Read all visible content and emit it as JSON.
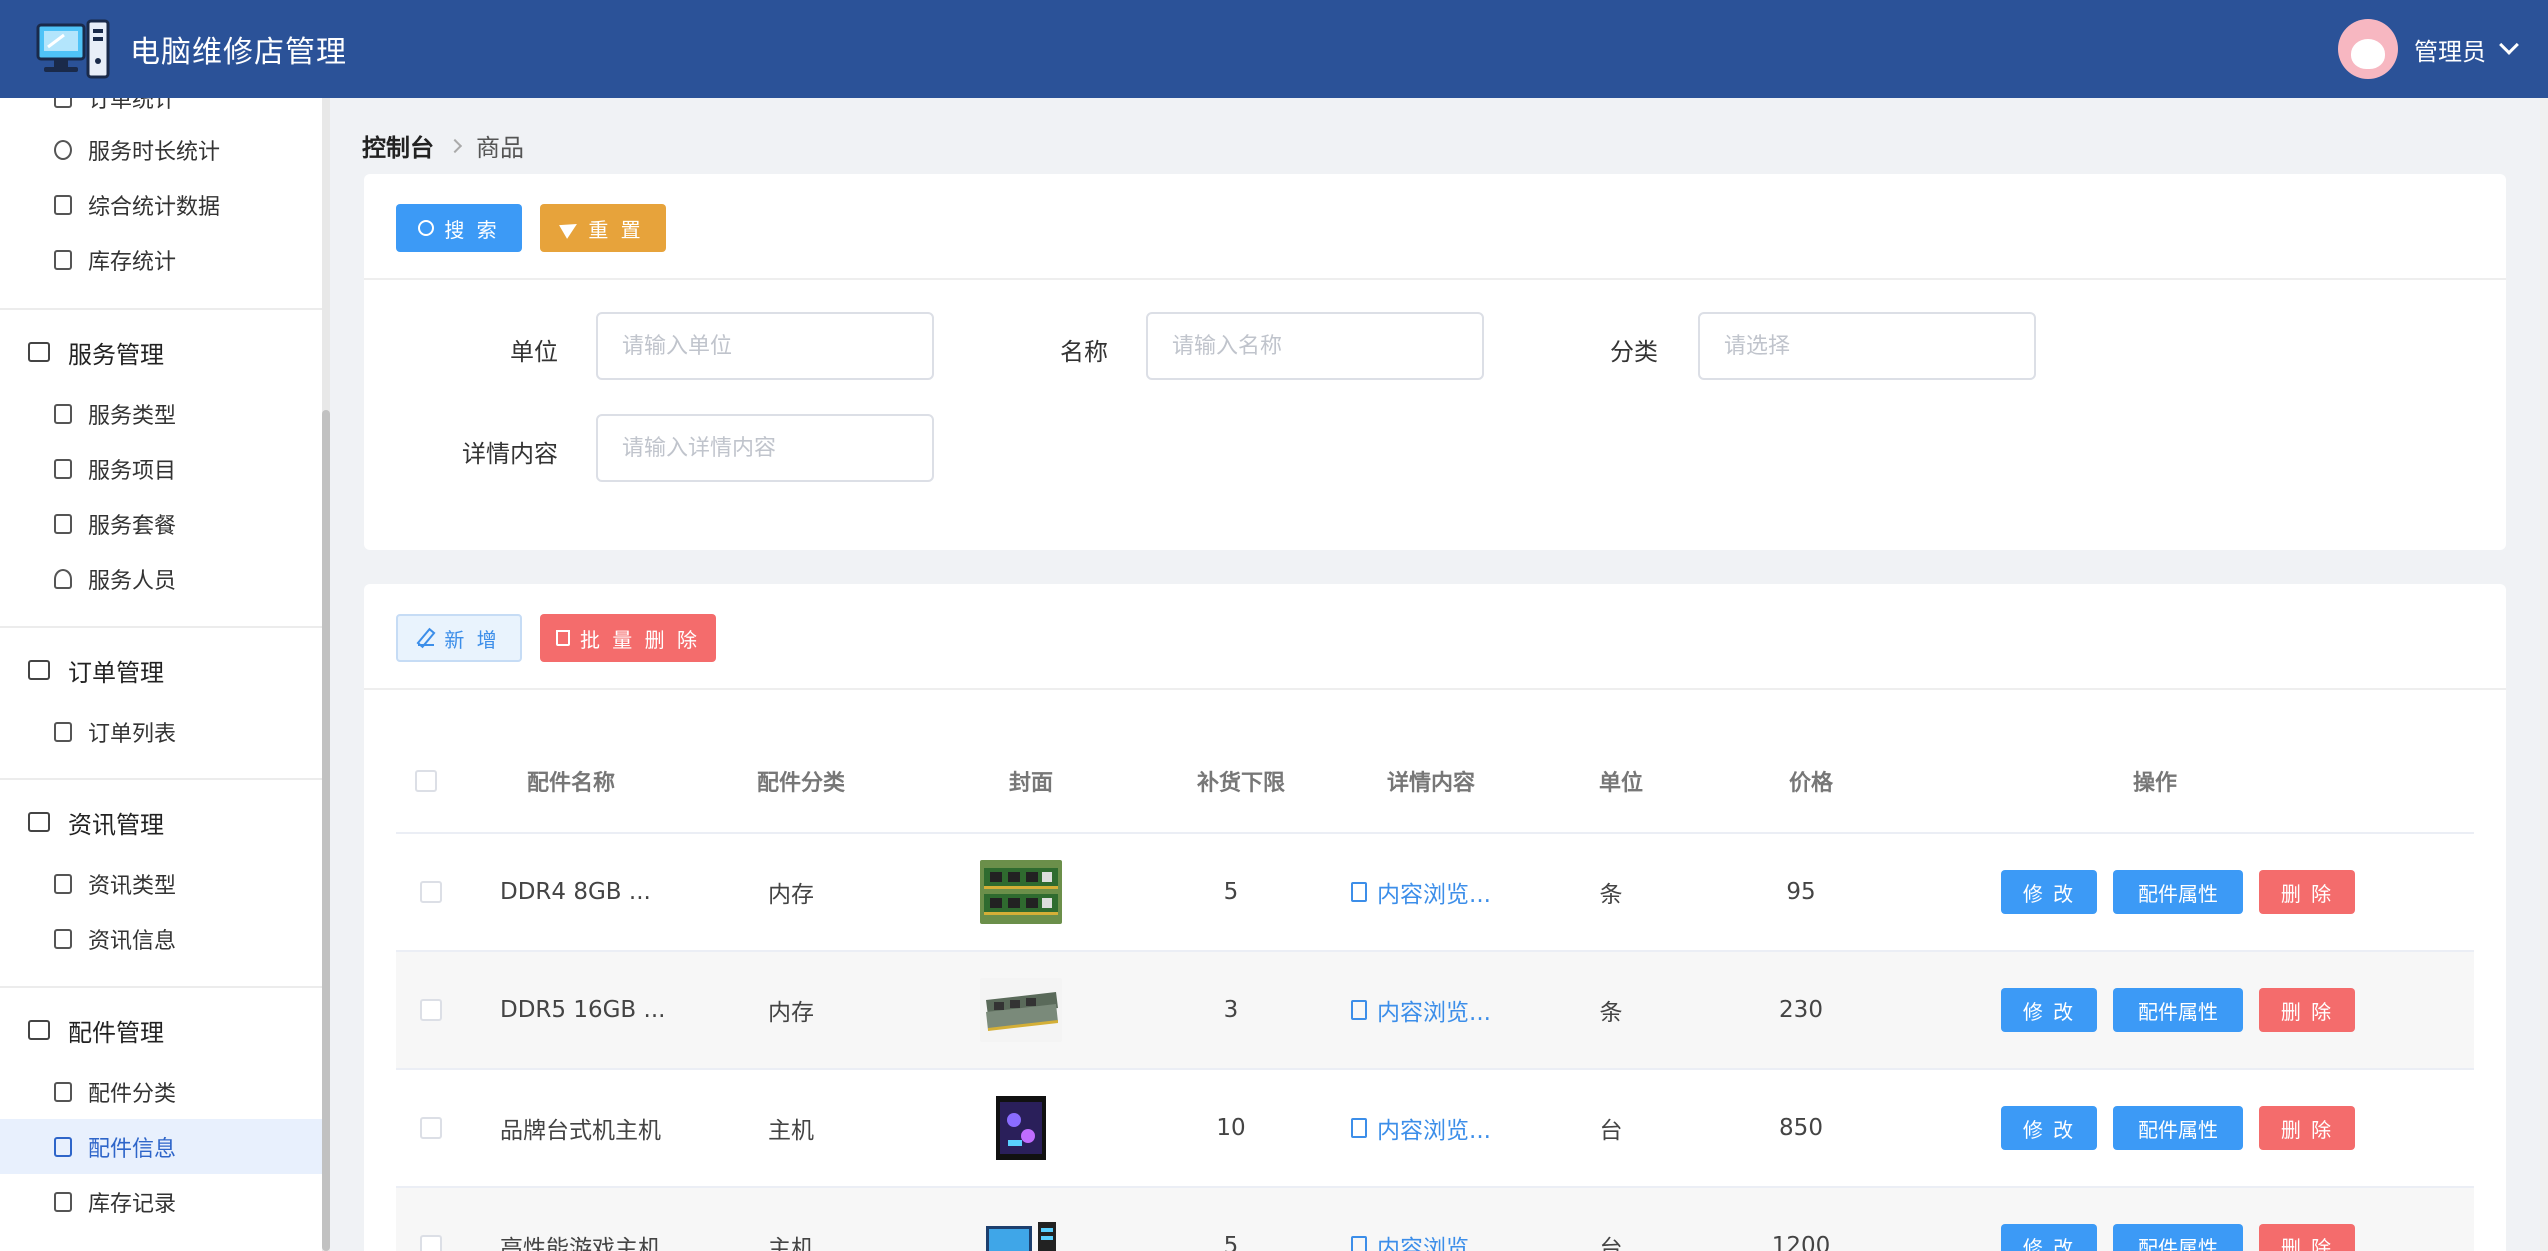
{
  "header": {
    "title": "电脑维修店管理",
    "user_label": "管理员"
  },
  "sidebar": {
    "items": [
      {
        "label": "订单统计",
        "type": "item"
      },
      {
        "label": "服务时长统计",
        "type": "item"
      },
      {
        "label": "综合统计数据",
        "type": "item"
      },
      {
        "label": "库存统计",
        "type": "item"
      },
      {
        "label": "服务管理",
        "type": "group"
      },
      {
        "label": "服务类型",
        "type": "item"
      },
      {
        "label": "服务项目",
        "type": "item"
      },
      {
        "label": "服务套餐",
        "type": "item"
      },
      {
        "label": "服务人员",
        "type": "item"
      },
      {
        "label": "订单管理",
        "type": "group"
      },
      {
        "label": "订单列表",
        "type": "item"
      },
      {
        "label": "资讯管理",
        "type": "group"
      },
      {
        "label": "资讯类型",
        "type": "item"
      },
      {
        "label": "资讯信息",
        "type": "item"
      },
      {
        "label": "配件管理",
        "type": "group"
      },
      {
        "label": "配件分类",
        "type": "item"
      },
      {
        "label": "配件信息",
        "type": "item",
        "active": true
      },
      {
        "label": "库存记录",
        "type": "item"
      }
    ]
  },
  "breadcrumb": {
    "home": "控制台",
    "current": "商品"
  },
  "search": {
    "search_label": "搜 索",
    "reset_label": "重 置",
    "fields": [
      {
        "label": "单位",
        "placeholder": "请输入单位"
      },
      {
        "label": "名称",
        "placeholder": "请输入名称"
      },
      {
        "label": "分类",
        "placeholder": "请选择"
      },
      {
        "label": "详情内容",
        "placeholder": "请输入详情内容"
      }
    ]
  },
  "toolbar": {
    "add_label": "新 增",
    "batch_delete_label": "批 量 删 除"
  },
  "table": {
    "columns": [
      "配件名称",
      "配件分类",
      "封面",
      "补货下限",
      "详情内容",
      "单位",
      "价格",
      "操作"
    ],
    "rows": [
      {
        "name": "DDR4 8GB ...",
        "category": "内存",
        "cover": "ram-green",
        "min_stock": "5",
        "detail": "内容浏览...",
        "unit": "条",
        "price": "95"
      },
      {
        "name": "DDR5 16GB ...",
        "category": "内存",
        "cover": "ram-gray",
        "min_stock": "3",
        "detail": "内容浏览...",
        "unit": "条",
        "price": "230"
      },
      {
        "name": "品牌台式机主机",
        "category": "主机",
        "cover": "pc-tower",
        "min_stock": "10",
        "detail": "内容浏览...",
        "unit": "台",
        "price": "850"
      },
      {
        "name": "高性能游戏主机",
        "category": "主机",
        "cover": "pc-setup",
        "min_stock": "5",
        "detail": "内容浏览...",
        "unit": "台",
        "price": "1200"
      }
    ],
    "ops": {
      "edit": "修 改",
      "attr": "配件属性",
      "delete": "删 除"
    }
  },
  "colors": {
    "header_bg": "#2b5298",
    "primary": "#3c9af6",
    "warning": "#e7a33b",
    "danger": "#f46c6c"
  }
}
